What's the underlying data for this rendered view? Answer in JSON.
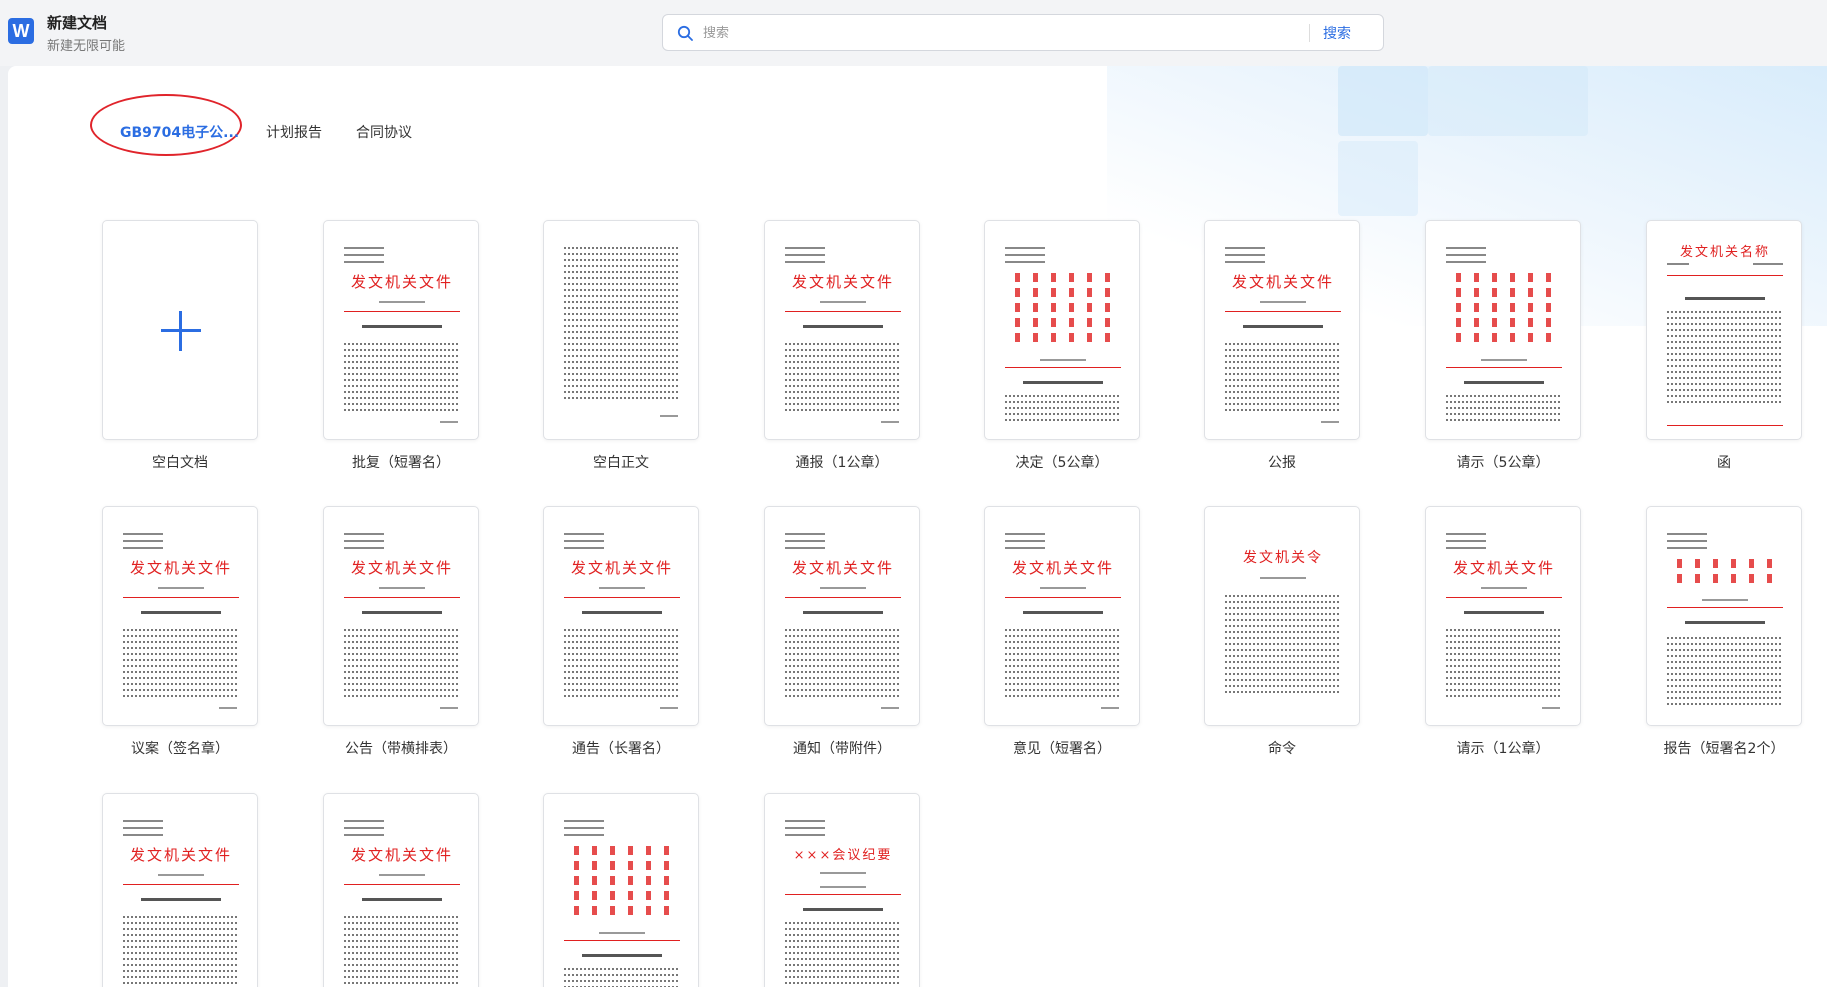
{
  "header": {
    "logo_letter": "W",
    "title": "新建文档",
    "subtitle": "新建无限可能",
    "search_placeholder": "搜索",
    "search_button": "搜索"
  },
  "tabs": [
    {
      "label": "GB9704电子公...",
      "active": true
    },
    {
      "label": "计划报告",
      "active": false
    },
    {
      "label": "合同协议",
      "active": false
    }
  ],
  "templates": [
    {
      "label": "空白文档",
      "kind": "blank"
    },
    {
      "label": "批复（短署名）",
      "kind": "red-header",
      "heading": "发文机关文件"
    },
    {
      "label": "空白正文",
      "kind": "plain"
    },
    {
      "label": "通报（1公章）",
      "kind": "red-header",
      "heading": "发文机关文件"
    },
    {
      "label": "决定（5公章）",
      "kind": "multi"
    },
    {
      "label": "公报",
      "kind": "red-header",
      "heading": "发文机关文件"
    },
    {
      "label": "请示（5公章）",
      "kind": "multi"
    },
    {
      "label": "函",
      "kind": "letter",
      "heading": "发文机关名称"
    },
    {
      "label": "议案（签名章）",
      "kind": "red-header",
      "heading": "发文机关文件"
    },
    {
      "label": "公告（带横排表）",
      "kind": "red-header",
      "heading": "发文机关文件"
    },
    {
      "label": "通告（长署名）",
      "kind": "red-header",
      "heading": "发文机关文件"
    },
    {
      "label": "通知（带附件）",
      "kind": "red-header",
      "heading": "发文机关文件"
    },
    {
      "label": "意见（短署名）",
      "kind": "red-header",
      "heading": "发文机关文件"
    },
    {
      "label": "命令",
      "kind": "order",
      "heading": "发文机关令"
    },
    {
      "label": "请示（1公章）",
      "kind": "red-header",
      "heading": "发文机关文件"
    },
    {
      "label": "报告（短署名2个）",
      "kind": "multi-small"
    },
    {
      "label": "",
      "kind": "red-header",
      "heading": "发文机关文件"
    },
    {
      "label": "",
      "kind": "red-header",
      "heading": "发文机关文件"
    },
    {
      "label": "",
      "kind": "multi"
    },
    {
      "label": "",
      "kind": "minutes",
      "heading": "×××会议纪要"
    }
  ],
  "colors": {
    "accent": "#2b6de2",
    "doc_red": "#e02020",
    "highlight_ring": "#e0242b"
  }
}
